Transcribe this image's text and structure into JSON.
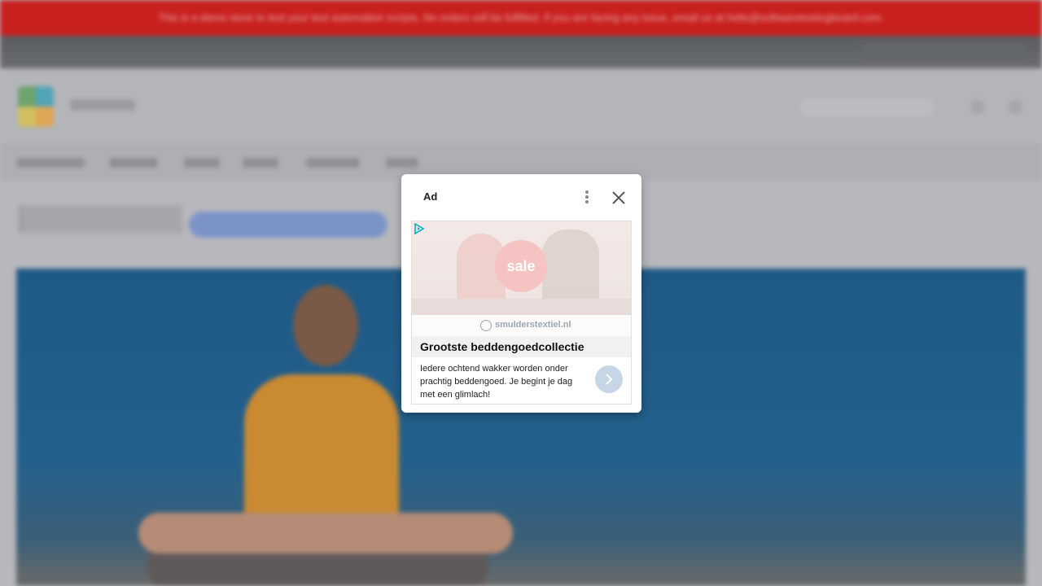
{
  "banner": {
    "text": "This is a demo store to test your test automation scripts. No orders will be fulfilled. If you are facing any issue, email us at hello@softwaretestingboard.com."
  },
  "ad": {
    "label": "Ad",
    "sale_badge": "sale",
    "brand": "smulderstextiel.nl",
    "headline": "Grootste beddengoedcollectie",
    "description": "Iedere ochtend wakker worden onder prachtig beddengoed. Je begint je dag met een glimlach!",
    "icons": {
      "more": "more-vert-icon",
      "close": "close-icon",
      "adchoices": "adchoices-icon",
      "cta": "chevron-right-icon"
    },
    "colors": {
      "cta": "#c6d6e6",
      "sale": "#f6c3c3",
      "adchoices": "#00aecd"
    }
  },
  "colors": {
    "banner": "#c8201e"
  }
}
